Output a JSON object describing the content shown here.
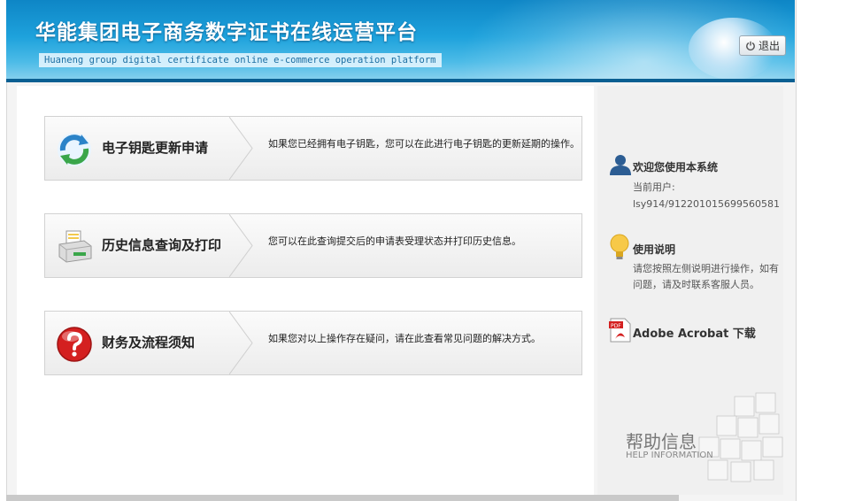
{
  "header": {
    "title": "华能集团电子商务数字证书在线运营平台",
    "subtitle": "Huaneng group digital certificate online e-commerce operation platform",
    "logout_label": "退出"
  },
  "cards": [
    {
      "label": "电子钥匙更新申请",
      "description": "如果您已经拥有电子钥匙，您可以在此进行电子钥匙的更新延期的操作。",
      "icon": "refresh-icon"
    },
    {
      "label": "历史信息查询及打印",
      "description": "您可以在此查询提交后的申请表受理状态并打印历史信息。",
      "icon": "printer-icon"
    },
    {
      "label": "财务及流程须知",
      "description": "如果您对以上操作存在疑问，请在此查看常见问题的解决方式。",
      "icon": "question-icon"
    }
  ],
  "sidebar": {
    "welcome_title": "欢迎您使用本系统",
    "current_user_label": "当前用户:",
    "current_user_value": "lsy914/912201015699560581",
    "usage_title": "使用说明",
    "usage_text": "请您按照左侧说明进行操作，如有问题，请及时联系客服人员。",
    "acrobat_label": "Adobe Acrobat 下载",
    "help_title": "帮助信息",
    "help_subtitle": "HELP INFORMATION"
  },
  "colors": {
    "header_blue": "#1ea2dc",
    "accent_green": "#3aa64a",
    "accent_red": "#d42020"
  }
}
